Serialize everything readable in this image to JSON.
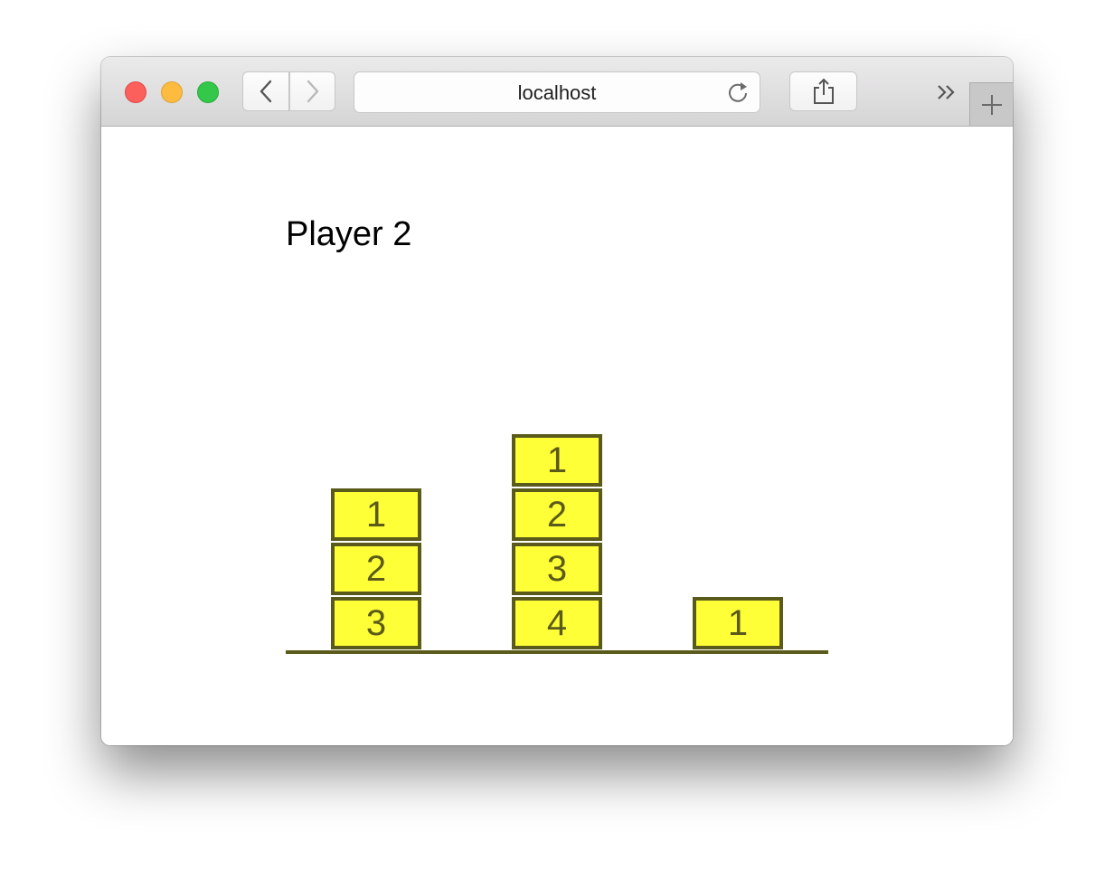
{
  "browser": {
    "address": "localhost"
  },
  "page": {
    "player_label": "Player 2",
    "accent_color": "#ffff38",
    "border_color": "#5a5a1a"
  },
  "piles": [
    {
      "blocks": [
        "1",
        "2",
        "3"
      ]
    },
    {
      "blocks": [
        "1",
        "2",
        "3",
        "4"
      ]
    },
    {
      "blocks": [
        "1"
      ]
    }
  ]
}
